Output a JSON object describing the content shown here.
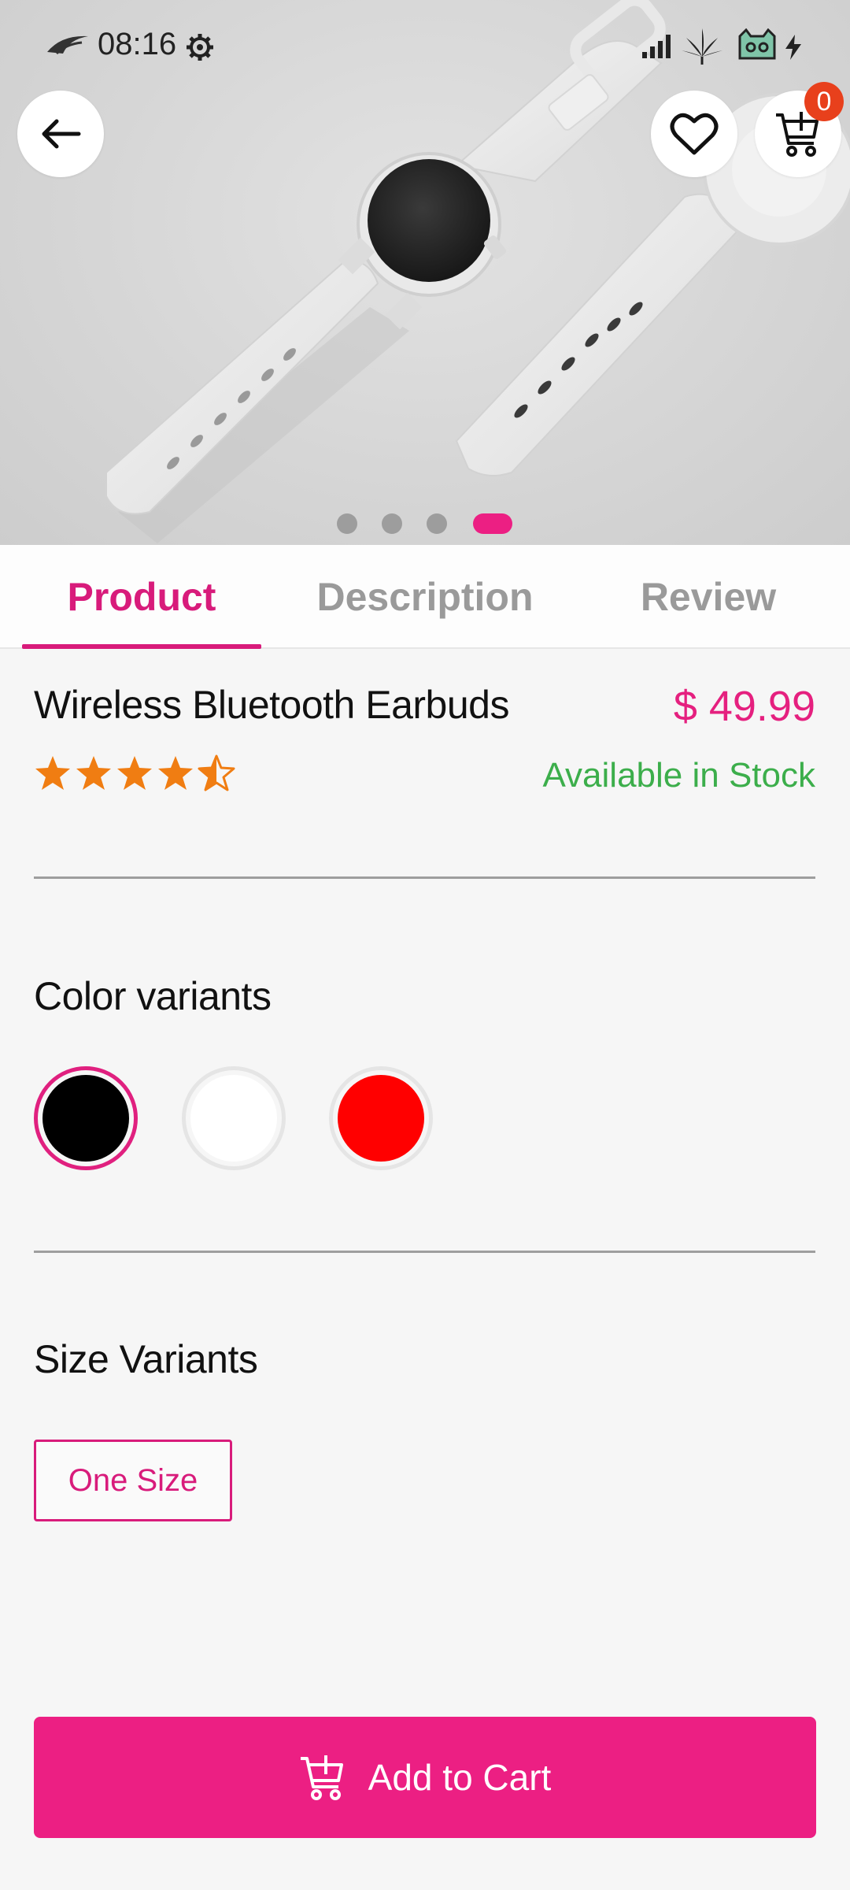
{
  "status_bar": {
    "time": "08:16",
    "icons": [
      "rog-logo-icon",
      "settings-gear-icon",
      "signal-icon",
      "leaf-icon",
      "cat-icon",
      "charging-icon"
    ]
  },
  "header": {
    "back_icon": "arrow-left-icon",
    "favorite_icon": "heart-icon",
    "cart_icon": "cart-add-icon",
    "cart_count": "0"
  },
  "carousel": {
    "total_slides": 4,
    "active_index": 3
  },
  "tabs": [
    {
      "label": "Product",
      "active": true
    },
    {
      "label": "Description",
      "active": false
    },
    {
      "label": "Review",
      "active": false
    }
  ],
  "product": {
    "name": "Wireless Bluetooth Earbuds",
    "price": "$ 49.99",
    "rating": 4.5,
    "rating_max": 5,
    "stock_status": "Available in Stock"
  },
  "color_section": {
    "title": "Color variants",
    "options": [
      {
        "color": "#000000",
        "selected": true
      },
      {
        "color": "#ffffff",
        "selected": false
      },
      {
        "color": "#ff0000",
        "selected": false
      }
    ]
  },
  "size_section": {
    "title": "Size Variants",
    "options": [
      {
        "label": "One Size",
        "selected": true
      }
    ]
  },
  "cta": {
    "label": "Add to Cart",
    "icon": "cart-add-icon"
  },
  "colors": {
    "accent": "#ec1f83",
    "price": "#e5207f",
    "stock": "#3cae4b",
    "star": "#f07d12",
    "badge": "#e8401c"
  }
}
